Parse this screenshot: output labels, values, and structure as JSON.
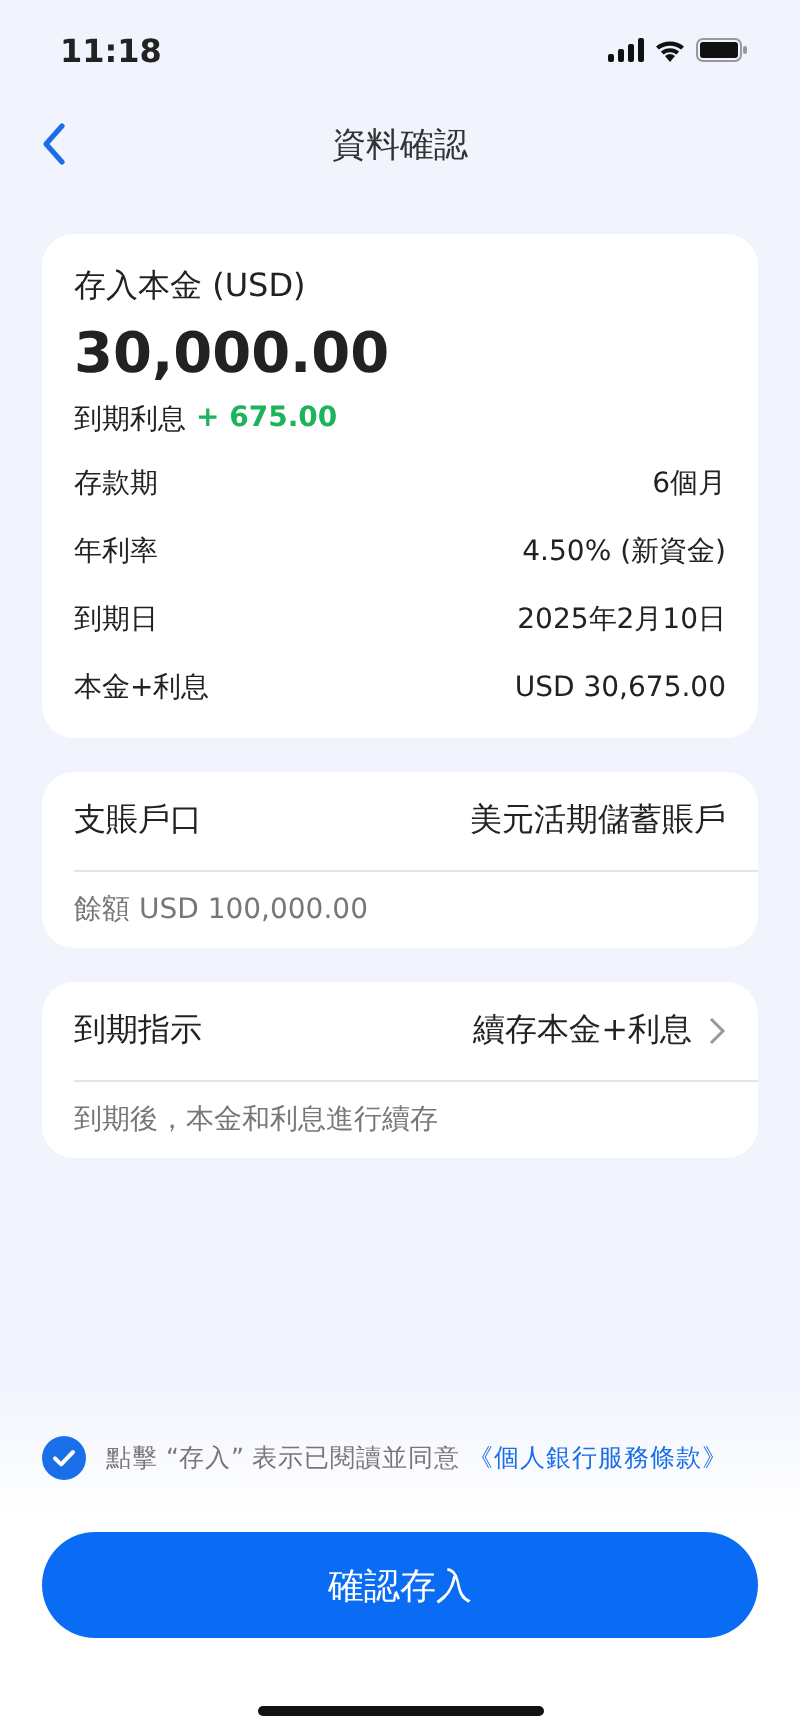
{
  "status_bar": {
    "time": "11:18"
  },
  "nav": {
    "title": "資料確認"
  },
  "deposit_card": {
    "label": "存入本金 (USD)",
    "amount": "30,000.00",
    "interest_label": "到期利息",
    "interest_value": "+ 675.00",
    "rows": [
      {
        "label": "存款期",
        "value": "6個月"
      },
      {
        "label": "年利率",
        "value": "4.50% (新資金)"
      },
      {
        "label": "到期日",
        "value": "2025年2月10日"
      },
      {
        "label": "本金+利息",
        "value": "USD 30,675.00"
      }
    ]
  },
  "account_card": {
    "label": "支賬戶口",
    "value": "美元活期儲蓄賬戶",
    "note": "餘額 USD 100,000.00"
  },
  "maturity_card": {
    "label": "到期指示",
    "value": "續存本金+利息",
    "note": "到期後，本金和利息進行續存"
  },
  "agreement": {
    "checked": true,
    "text": "點擊 “存入” 表示已閱讀並同意",
    "link": "《個人銀行服務條款》"
  },
  "confirm_button": "確認存入"
}
